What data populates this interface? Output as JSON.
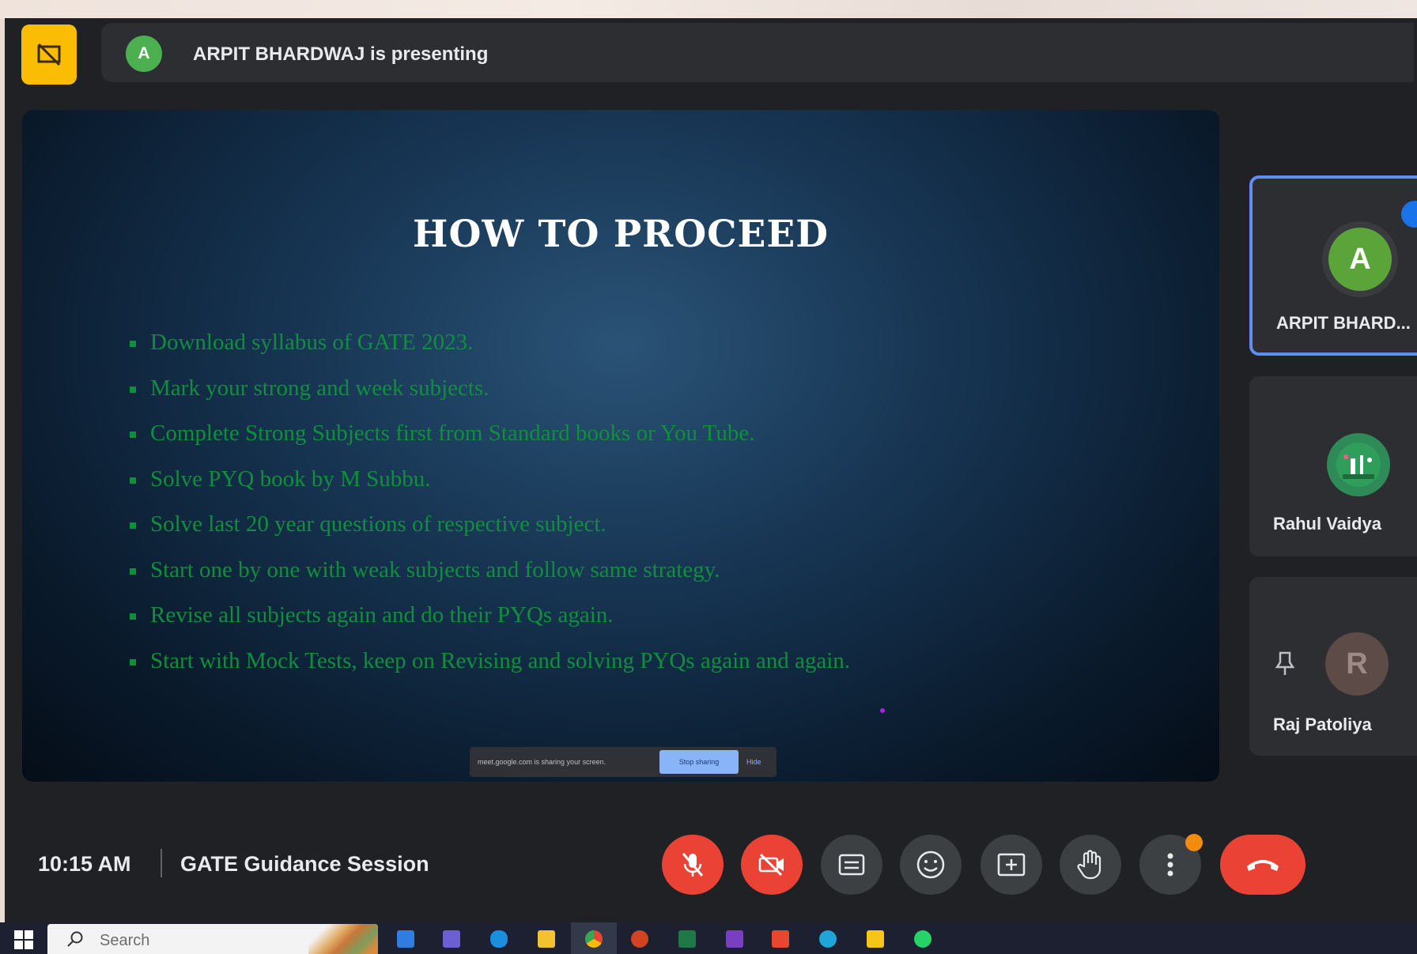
{
  "header": {
    "presenter_initial": "A",
    "presenting_text": "ARPIT BHARDWAJ is presenting"
  },
  "slide": {
    "title": "HOW TO PROCEED",
    "bullets": [
      "Download syllabus of GATE 2023.",
      "Mark your strong and week subjects.",
      "Complete Strong Subjects first from Standard books or You Tube.",
      "Solve PYQ book by M Subbu.",
      "Solve last 20 year questions of respective subject.",
      "Start one by one with weak subjects and follow same strategy.",
      "Revise all subjects again and do their PYQs again.",
      "Start with Mock Tests, keep on Revising and solving PYQs again and again."
    ],
    "share_notice": "meet.google.com is sharing your screen.",
    "share_stop": "Stop sharing",
    "share_hide": "Hide"
  },
  "participants": [
    {
      "initial": "A",
      "name": "ARPIT BHARD...",
      "avatar_color": "#5aa43a"
    },
    {
      "initial": "",
      "name": "Rahul Vaidya",
      "avatar_color": "#2e8b57"
    },
    {
      "initial": "R",
      "name": "Raj Patoliya",
      "avatar_color": "#5d4b47"
    }
  ],
  "footer": {
    "time": "10:15 AM",
    "meeting_title": "GATE Guidance Session"
  },
  "controls": [
    "mic-off",
    "camera-off",
    "captions",
    "emoji",
    "present",
    "raise-hand",
    "more-options",
    "leave-call"
  ],
  "taskbar": {
    "search_placeholder": "Search"
  },
  "colors": {
    "accent_red": "#ea4335",
    "active_border": "#5f8ef0",
    "bullet_green": "#0f8f3c",
    "app_yellow": "#fbbc04"
  }
}
